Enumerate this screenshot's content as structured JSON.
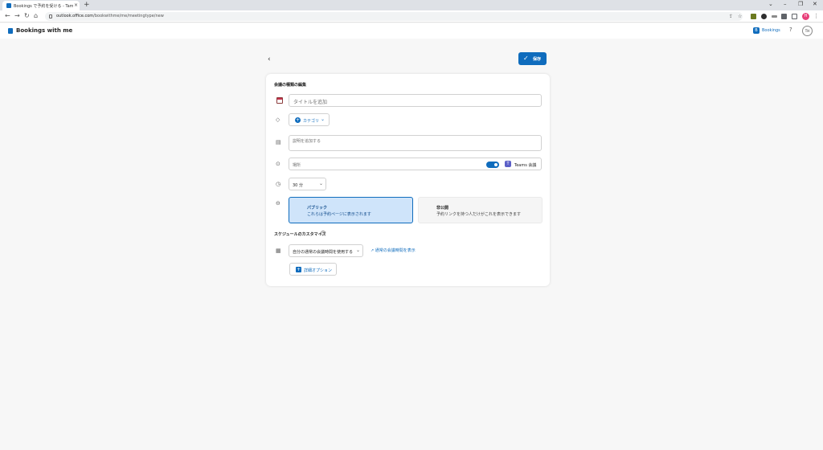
{
  "browser": {
    "tab_title": "Bookings で予約を受ける - Tamura",
    "tab_close": "×",
    "new_tab": "+",
    "url_host": "outlook.office.com",
    "url_path": "/bookwithme/me/meetingtype/new",
    "win_minimize": "–",
    "win_maximize": "❐",
    "win_close": "✕",
    "win_dropdown": "⌄",
    "profile_initial": "H",
    "menu": "⋮"
  },
  "app": {
    "title": "Bookings with me",
    "bookings_logo_letter": "B",
    "bookings_label": "Bookings",
    "help": "?",
    "avatar_initials": "TH"
  },
  "page": {
    "back": "‹",
    "save_label": "保存",
    "save_check": "✓"
  },
  "form": {
    "heading": "会議の種類の編集",
    "title_placeholder": "タイトルを追加",
    "category_label": "カテゴリ",
    "description_placeholder": "説明を追加する",
    "location_placeholder": "場所",
    "teams_label": "Teams 会議",
    "duration_value": "30 分",
    "public_title": "パブリック",
    "public_desc": "これらは予約ページに表示されます",
    "private_title": "非公開",
    "private_desc": "予約リンクを持つ人だけがこれを表示できます",
    "schedule_heading": "スケジュールのカスタマイズ",
    "hours_value": "自分の通常の会議時間を使用する",
    "hours_link": "通常の会議時間を表示",
    "advanced_label": "詳細オプション"
  },
  "colors": {
    "accent": "#0f6cbd",
    "public_bg": "#cfe4fa",
    "teams": "#5b5fc7"
  }
}
